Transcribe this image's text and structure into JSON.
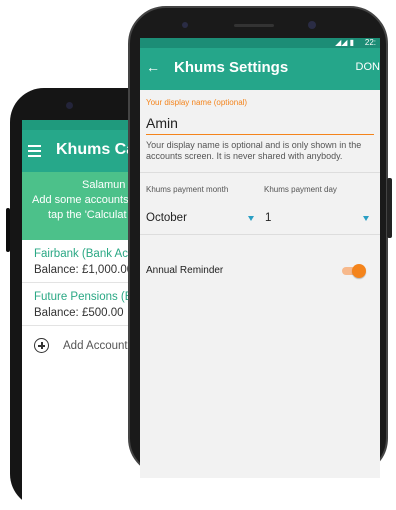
{
  "back_screen": {
    "title": "Khums Calc",
    "banner_lines": [
      "Salamun A",
      "Add some accounts",
      "tap the 'Calculat"
    ],
    "accounts": [
      {
        "name": "Fairbank (Bank Acco",
        "balance": "Balance: £1,000.00"
      },
      {
        "name": "Future Pensions (Ban",
        "balance": "Balance: £500.00"
      }
    ],
    "add_account": "Add Account..."
  },
  "front_screen": {
    "status_time": "22:",
    "title": "Khums Settings",
    "done_label": "DON",
    "display_name_label": "Your display name (optional)",
    "display_name_value": "Amin",
    "helper_text": "Your display name is optional and is only shown in the accounts screen. It is never shared with anybody.",
    "payment_month_label": "Khums payment month",
    "payment_day_label": "Khums payment day",
    "payment_month_value": "October",
    "payment_day_value": "1",
    "reminder_label": "Annual Reminder",
    "reminder_on": true
  },
  "colors": {
    "accent": "#f4841c",
    "appbar": "#25a68a",
    "banner": "#4cc18a"
  },
  "icons": [
    "hamburger-icon",
    "add-circle-icon",
    "back-arrow-icon",
    "dropdown-caret-icon"
  ]
}
